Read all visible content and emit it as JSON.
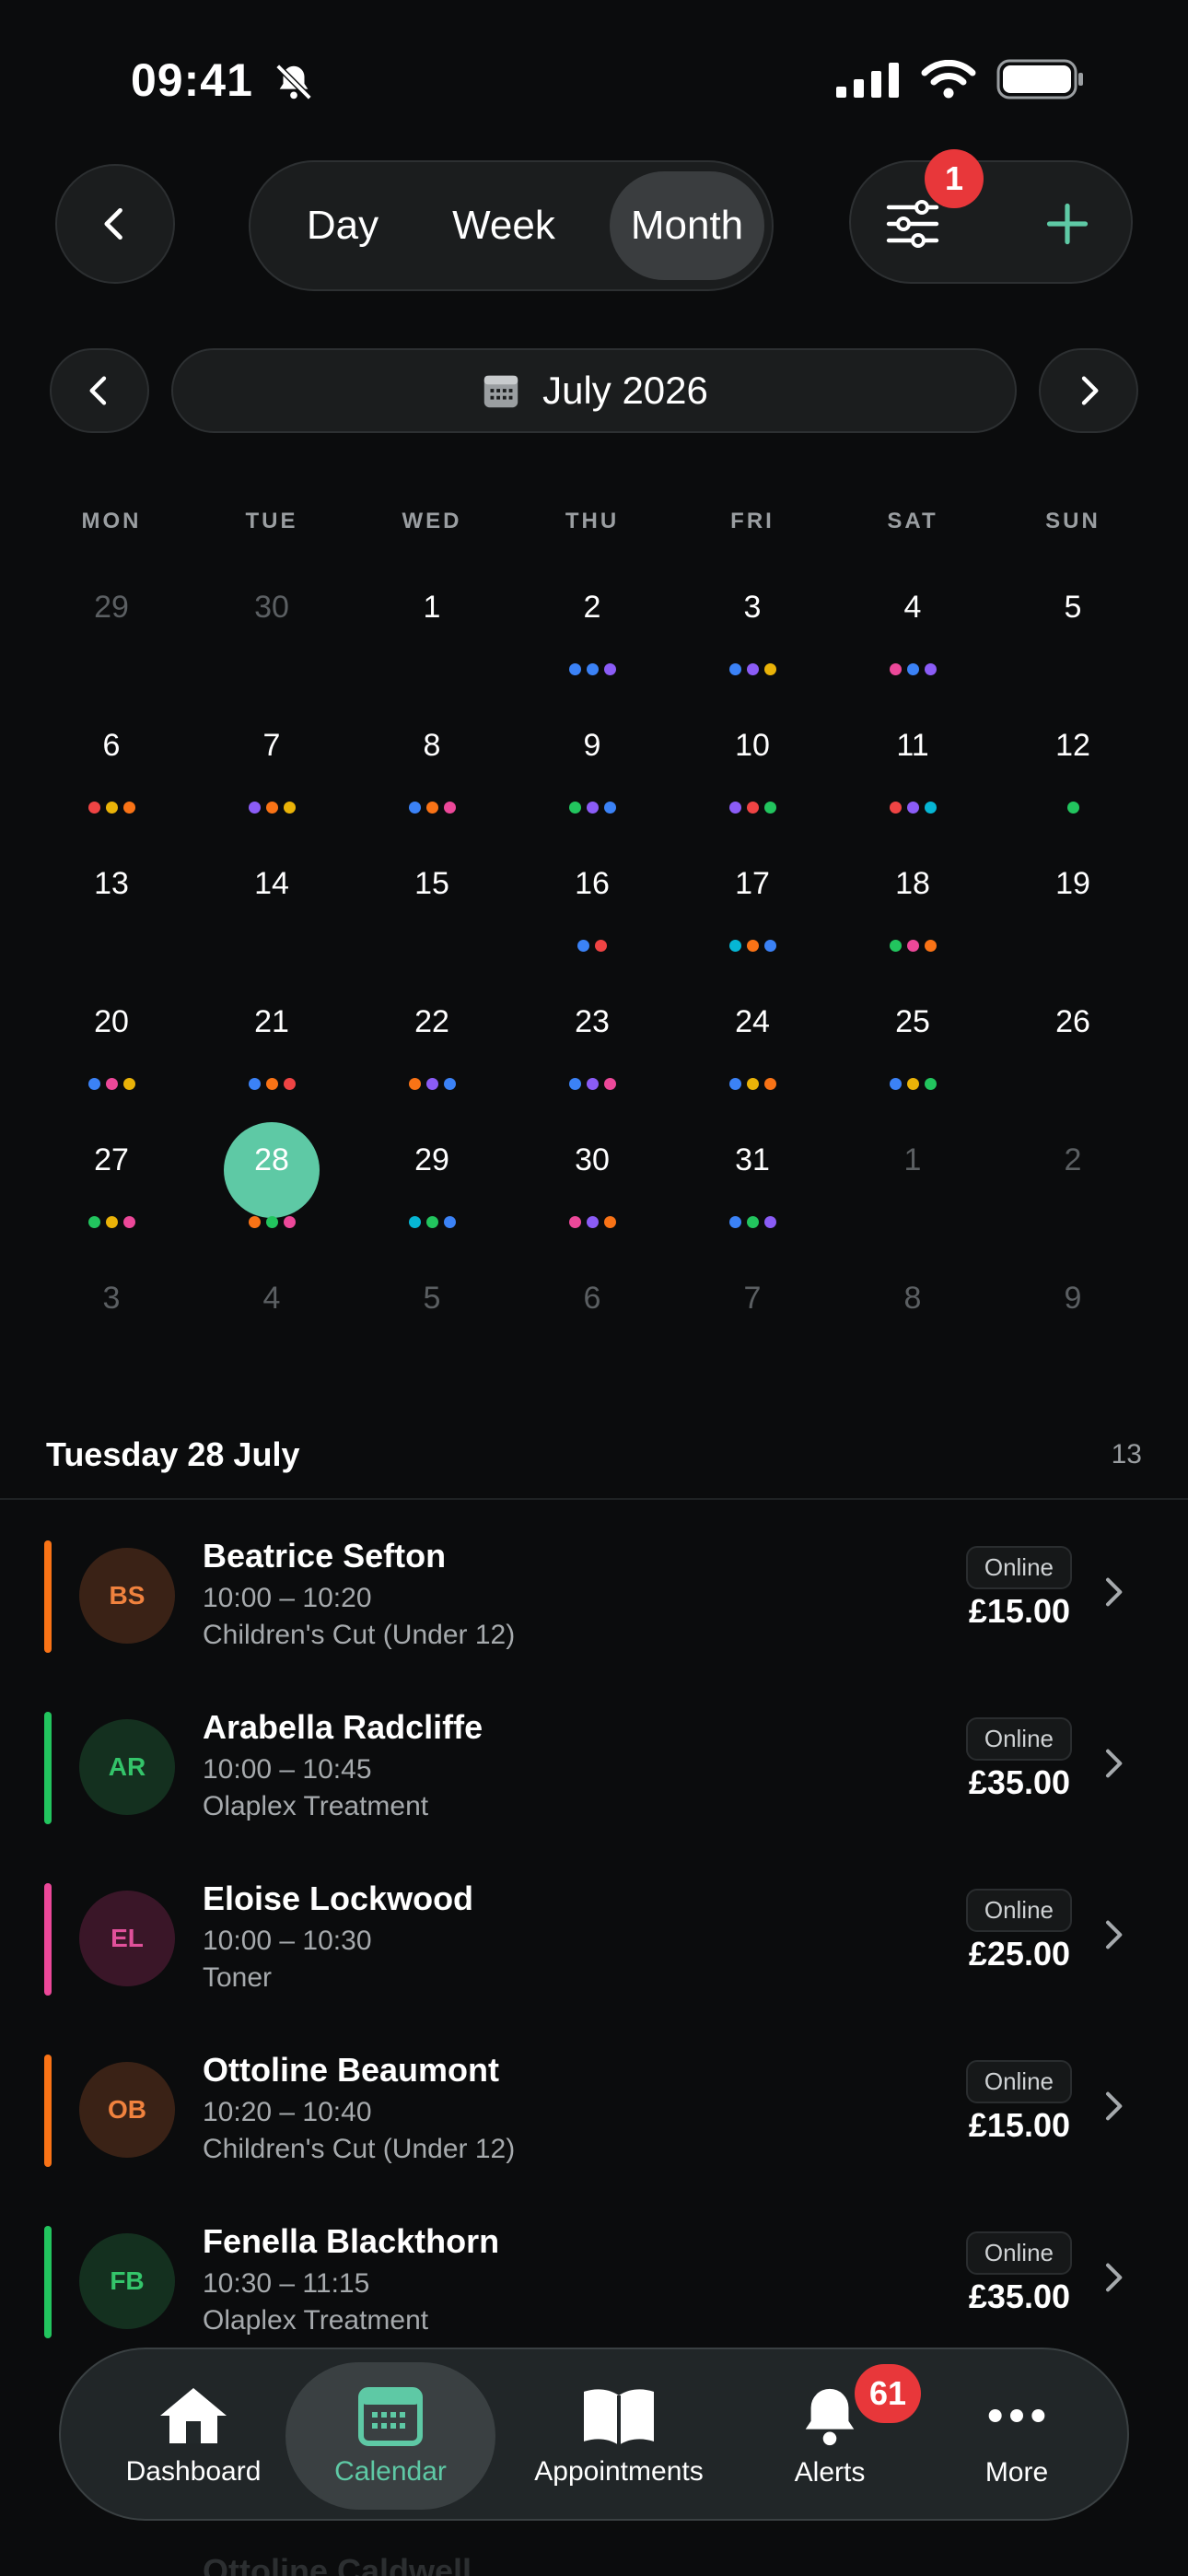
{
  "status": {
    "time": "09:41"
  },
  "header": {
    "segments": [
      "Day",
      "Week",
      "Month"
    ],
    "active_segment": "Month",
    "filter_badge": "1",
    "month_label": "July 2026"
  },
  "calendar": {
    "weekdays": [
      "MON",
      "TUE",
      "WED",
      "THU",
      "FRI",
      "SAT",
      "SUN"
    ],
    "selected_day": "28",
    "weeks": [
      [
        {
          "d": "29",
          "dim": true,
          "dots": []
        },
        {
          "d": "30",
          "dim": true,
          "dots": []
        },
        {
          "d": "1",
          "dots": []
        },
        {
          "d": "2",
          "dots": [
            "#3b82f6",
            "#3b82f6",
            "#8b5cf6"
          ]
        },
        {
          "d": "3",
          "dots": [
            "#3b82f6",
            "#8b5cf6",
            "#eab308"
          ]
        },
        {
          "d": "4",
          "dots": [
            "#ec4899",
            "#3b82f6",
            "#8b5cf6"
          ]
        },
        {
          "d": "5",
          "dots": []
        }
      ],
      [
        {
          "d": "6",
          "dots": [
            "#ef4444",
            "#eab308",
            "#f97316"
          ]
        },
        {
          "d": "7",
          "dots": [
            "#8b5cf6",
            "#f97316",
            "#eab308"
          ]
        },
        {
          "d": "8",
          "dots": [
            "#3b82f6",
            "#f97316",
            "#ec4899"
          ]
        },
        {
          "d": "9",
          "dots": [
            "#22c55e",
            "#8b5cf6",
            "#3b82f6"
          ]
        },
        {
          "d": "10",
          "dots": [
            "#8b5cf6",
            "#ef4444",
            "#22c55e"
          ]
        },
        {
          "d": "11",
          "dots": [
            "#ef4444",
            "#8b5cf6",
            "#06b6d4"
          ]
        },
        {
          "d": "12",
          "dots": [
            "#22c55e"
          ]
        }
      ],
      [
        {
          "d": "13",
          "dots": []
        },
        {
          "d": "14",
          "dots": []
        },
        {
          "d": "15",
          "dots": []
        },
        {
          "d": "16",
          "dots": [
            "#3b82f6",
            "#ef4444"
          ]
        },
        {
          "d": "17",
          "dots": [
            "#06b6d4",
            "#f97316",
            "#3b82f6"
          ]
        },
        {
          "d": "18",
          "dots": [
            "#22c55e",
            "#ec4899",
            "#f97316"
          ]
        },
        {
          "d": "19",
          "dots": []
        }
      ],
      [
        {
          "d": "20",
          "dots": [
            "#3b82f6",
            "#ec4899",
            "#eab308"
          ]
        },
        {
          "d": "21",
          "dots": [
            "#3b82f6",
            "#f97316",
            "#ef4444"
          ]
        },
        {
          "d": "22",
          "dots": [
            "#f97316",
            "#8b5cf6",
            "#3b82f6"
          ]
        },
        {
          "d": "23",
          "dots": [
            "#3b82f6",
            "#8b5cf6",
            "#ec4899"
          ]
        },
        {
          "d": "24",
          "dots": [
            "#3b82f6",
            "#eab308",
            "#f97316"
          ]
        },
        {
          "d": "25",
          "dots": [
            "#3b82f6",
            "#eab308",
            "#22c55e"
          ]
        },
        {
          "d": "26",
          "dots": []
        }
      ],
      [
        {
          "d": "27",
          "dots": [
            "#22c55e",
            "#eab308",
            "#ec4899"
          ]
        },
        {
          "d": "28",
          "dots": [
            "#f97316",
            "#22c55e",
            "#ec4899"
          ]
        },
        {
          "d": "29",
          "dots": [
            "#06b6d4",
            "#22c55e",
            "#3b82f6"
          ]
        },
        {
          "d": "30",
          "dots": [
            "#ec4899",
            "#8b5cf6",
            "#f97316"
          ]
        },
        {
          "d": "31",
          "dots": [
            "#3b82f6",
            "#22c55e",
            "#8b5cf6"
          ]
        },
        {
          "d": "1",
          "dim": true,
          "dots": []
        },
        {
          "d": "2",
          "dim": true,
          "dots": []
        }
      ],
      [
        {
          "d": "3",
          "dim": true,
          "dots": []
        },
        {
          "d": "4",
          "dim": true,
          "dots": []
        },
        {
          "d": "5",
          "dim": true,
          "dots": []
        },
        {
          "d": "6",
          "dim": true,
          "dots": []
        },
        {
          "d": "7",
          "dim": true,
          "dots": []
        },
        {
          "d": "8",
          "dim": true,
          "dots": []
        },
        {
          "d": "9",
          "dim": true,
          "dots": []
        }
      ]
    ]
  },
  "list": {
    "title": "Tuesday 28 July",
    "count": "13",
    "appointments": [
      {
        "initials": "BS",
        "name": "Beatrice Sefton",
        "time": "10:00 – 10:20",
        "service": "Children's Cut (Under 12)",
        "tag": "Online",
        "price": "£15.00",
        "color": "#f97316",
        "avatar_bg": "#3a2216",
        "avatar_fg": "#f0823e"
      },
      {
        "initials": "AR",
        "name": "Arabella Radcliffe",
        "time": "10:00 – 10:45",
        "service": "Olaplex Treatment",
        "tag": "Online",
        "price": "£35.00",
        "color": "#22c55e",
        "avatar_bg": "#14301f",
        "avatar_fg": "#34c46a"
      },
      {
        "initials": "EL",
        "name": "Eloise Lockwood",
        "time": "10:00 – 10:30",
        "service": "Toner",
        "tag": "Online",
        "price": "£25.00",
        "color": "#ec4899",
        "avatar_bg": "#3a1628",
        "avatar_fg": "#e0509a"
      },
      {
        "initials": "OB",
        "name": "Ottoline Beaumont",
        "time": "10:20 – 10:40",
        "service": "Children's Cut (Under 12)",
        "tag": "Online",
        "price": "£15.00",
        "color": "#f97316",
        "avatar_bg": "#3a2216",
        "avatar_fg": "#f0823e"
      },
      {
        "initials": "FB",
        "name": "Fenella Blackthorn",
        "time": "10:30 – 11:15",
        "service": "Olaplex Treatment",
        "tag": "Online",
        "price": "£35.00",
        "color": "#22c55e",
        "avatar_bg": "#14301f",
        "avatar_fg": "#34c46a"
      }
    ],
    "ghost_name": "Ottoline Caldwell"
  },
  "tabbar": {
    "items": [
      {
        "label": "Dashboard",
        "icon": "home-icon"
      },
      {
        "label": "Calendar",
        "icon": "calendar-icon",
        "active": true
      },
      {
        "label": "Appointments",
        "icon": "book-icon"
      },
      {
        "label": "Alerts",
        "icon": "bell-icon",
        "badge": "61"
      },
      {
        "label": "More",
        "icon": "more-icon"
      }
    ]
  },
  "colors": {
    "accent": "#5ec9a5",
    "badge": "#e8373a"
  }
}
